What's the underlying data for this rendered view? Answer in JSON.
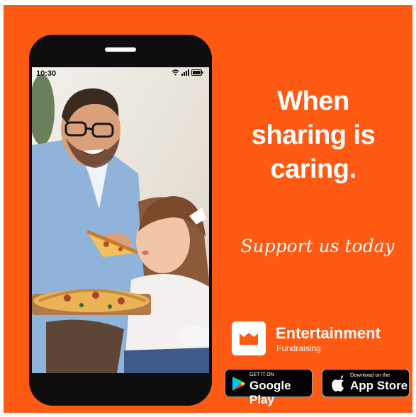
{
  "colors": {
    "background": "#ff5a13",
    "text": "#ffffff"
  },
  "phone": {
    "status_time": "10:30",
    "status_icons": [
      "wifi-icon",
      "signal-icon",
      "battery-icon"
    ],
    "photo_description_icon": "photo"
  },
  "headline": [
    "When",
    "sharing is",
    "caring."
  ],
  "tagline": "Support us today",
  "brand": {
    "name": "Entertainment",
    "subtitle": "Fundraising"
  },
  "badges": {
    "google_play": {
      "small": "GET IT ON",
      "big": "Google Play"
    },
    "app_store": {
      "small": "Download on the",
      "big": "App Store"
    }
  }
}
